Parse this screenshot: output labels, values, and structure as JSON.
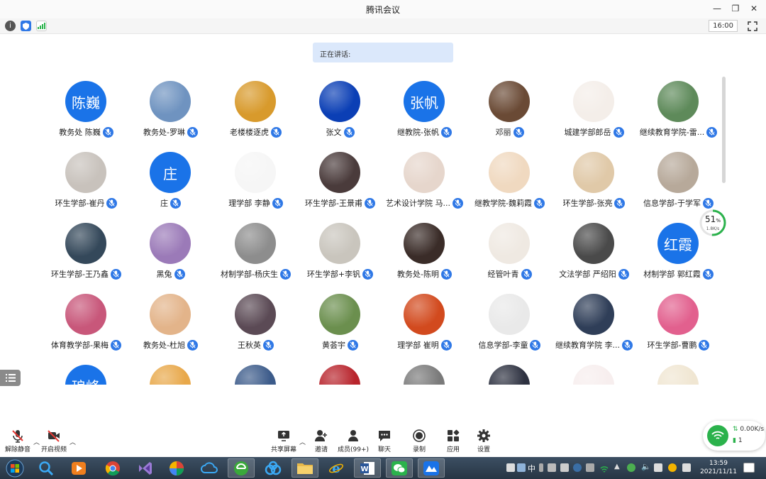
{
  "window": {
    "title": "腾讯会议"
  },
  "statusbar": {
    "clock": "16:00"
  },
  "speaking_label": "正在讲话:",
  "participants": [
    {
      "name": "教务处 陈巍",
      "avatar_text": "陈巍",
      "color": "#1a73e8"
    },
    {
      "name": "教务处-罗琳",
      "avatar_text": "",
      "color": "#6f93c0"
    },
    {
      "name": "老楼楼逐虎",
      "avatar_text": "",
      "color": "#d89a2c"
    },
    {
      "name": "张文",
      "avatar_text": "",
      "color": "#0b3fb5"
    },
    {
      "name": "继教院-张帆",
      "avatar_text": "张帆",
      "color": "#1a73e8"
    },
    {
      "name": "邓丽",
      "avatar_text": "",
      "color": "#6a4a35"
    },
    {
      "name": "城建学部郎岳",
      "avatar_text": "",
      "color": "#f4eee9"
    },
    {
      "name": "继续教育学院-雷...",
      "avatar_text": "",
      "color": "#5e8a5a"
    },
    {
      "name": "环生学部-崔丹",
      "avatar_text": "",
      "color": "#c8c2bc"
    },
    {
      "name": "庄",
      "avatar_text": "庄",
      "color": "#1a73e8"
    },
    {
      "name": "理学部 李静",
      "avatar_text": "",
      "color": "#f6f6f6"
    },
    {
      "name": "环生学部-王景甫",
      "avatar_text": "",
      "color": "#4a3b3b"
    },
    {
      "name": "艺术设计学院 马...",
      "avatar_text": "",
      "color": "#e6d6cc"
    },
    {
      "name": "继教学院-魏莉霞",
      "avatar_text": "",
      "color": "#f0d9c0"
    },
    {
      "name": "环生学部-张亮",
      "avatar_text": "",
      "color": "#e0c9a8"
    },
    {
      "name": "信息学部-于学军",
      "avatar_text": "",
      "color": "#b7a99a"
    },
    {
      "name": "环生学部-王乃鑫",
      "avatar_text": "",
      "color": "#34485a"
    },
    {
      "name": "黑兔",
      "avatar_text": "",
      "color": "#9b7ab8"
    },
    {
      "name": "材制学部-杨庆生",
      "avatar_text": "",
      "color": "#8d8d8d"
    },
    {
      "name": "环生学部+李钒",
      "avatar_text": "",
      "color": "#c9c5bd"
    },
    {
      "name": "教务处-陈明",
      "avatar_text": "",
      "color": "#3a2c28"
    },
    {
      "name": "经管叶青",
      "avatar_text": "",
      "color": "#efe9e2"
    },
    {
      "name": "文法学部 严绍阳",
      "avatar_text": "",
      "color": "#4a4a4a"
    },
    {
      "name": "材制学部 郭红霞",
      "avatar_text": "红霞",
      "color": "#1a73e8"
    },
    {
      "name": "体育教学部-果梅",
      "avatar_text": "",
      "color": "#c8577a"
    },
    {
      "name": "教务处-杜旭",
      "avatar_text": "",
      "color": "#e3b48a"
    },
    {
      "name": "王秋英",
      "avatar_text": "",
      "color": "#5b4a55"
    },
    {
      "name": "黄荟宇",
      "avatar_text": "",
      "color": "#6b8f4e"
    },
    {
      "name": "理学部 崔明",
      "avatar_text": "",
      "color": "#d24a1e"
    },
    {
      "name": "信息学部-李童",
      "avatar_text": "",
      "color": "#e9e9e9"
    },
    {
      "name": "继续教育学院 李...",
      "avatar_text": "",
      "color": "#2f3e58"
    },
    {
      "name": "环生学部-曹鹏",
      "avatar_text": "",
      "color": "#e2608e"
    },
    {
      "name": "",
      "avatar_text": "琅峰",
      "color": "#1a73e8"
    },
    {
      "name": "",
      "avatar_text": "",
      "color": "#e8a84a"
    },
    {
      "name": "",
      "avatar_text": "",
      "color": "#3c5b8a"
    },
    {
      "name": "",
      "avatar_text": "",
      "color": "#b8242c"
    },
    {
      "name": "",
      "avatar_text": "",
      "color": "#7a7a7a"
    },
    {
      "name": "",
      "avatar_text": "",
      "color": "#2d3140"
    },
    {
      "name": "",
      "avatar_text": "",
      "color": "#f7eeee"
    },
    {
      "name": "",
      "avatar_text": "",
      "color": "#f0e6d2"
    }
  ],
  "network_gauge": {
    "percent": "51",
    "unit": "%",
    "rate": "1.8K/s"
  },
  "toolbar": {
    "unmute": "解除静音",
    "start_video": "开启视频",
    "share_screen": "共享屏幕",
    "invite": "邀请",
    "members": "成员(99+)",
    "chat": "聊天",
    "record": "录制",
    "apps": "应用",
    "settings": "设置"
  },
  "network_card": {
    "speed": "0.00K/s",
    "count": "1"
  },
  "taskbar": {
    "ime": "中",
    "time": "13:59",
    "date": "2021/11/11"
  },
  "colors": {
    "accent": "#1a73e8",
    "mic": "#2f78e6",
    "wifi": "#2bb24c"
  }
}
